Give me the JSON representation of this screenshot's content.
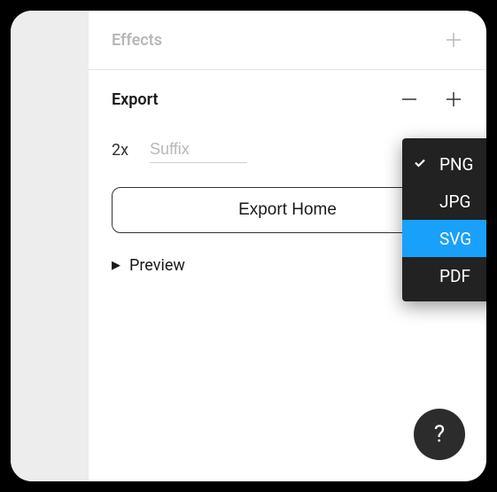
{
  "effects": {
    "title": "Effects"
  },
  "export": {
    "title": "Export",
    "scale": "2x",
    "suffix_placeholder": "Suffix",
    "suffix_value": "",
    "button_label": "Export Home",
    "preview_label": "Preview",
    "more_icon": "more-options"
  },
  "dropdown": {
    "items": [
      {
        "label": "PNG",
        "checked": true,
        "hover": false
      },
      {
        "label": "JPG",
        "checked": false,
        "hover": false
      },
      {
        "label": "SVG",
        "checked": false,
        "hover": true
      },
      {
        "label": "PDF",
        "checked": false,
        "hover": false
      }
    ]
  },
  "help": {
    "label": "?"
  }
}
